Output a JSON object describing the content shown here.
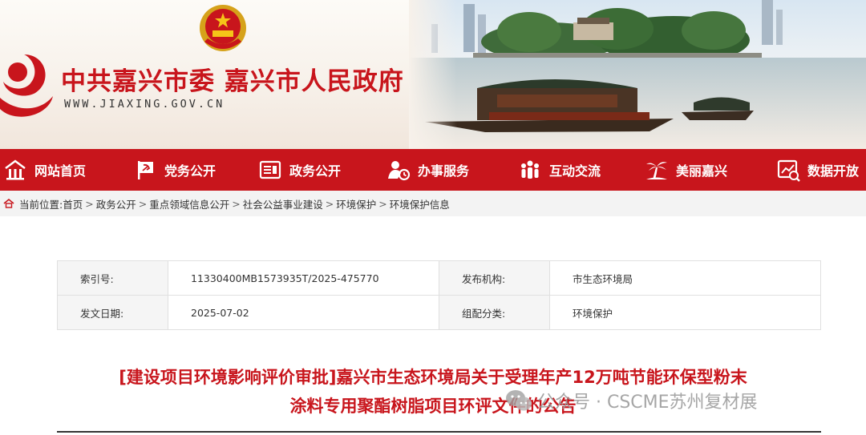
{
  "header": {
    "site_title": "中共嘉兴市委  嘉兴市人民政府",
    "site_url": "WWW.JIAXING.GOV.CN"
  },
  "nav": {
    "items": [
      {
        "label": "网站首页",
        "icon": "home-icon"
      },
      {
        "label": "党务公开",
        "icon": "party-flag-icon"
      },
      {
        "label": "政务公开",
        "icon": "document-icon"
      },
      {
        "label": "办事服务",
        "icon": "service-icon"
      },
      {
        "label": "互动交流",
        "icon": "people-icon"
      },
      {
        "label": "美丽嘉兴",
        "icon": "palm-tree-icon"
      },
      {
        "label": "数据开放",
        "icon": "data-icon"
      }
    ]
  },
  "breadcrumb": {
    "prefix": "当前位置:",
    "items": [
      "首页",
      "政务公开",
      "重点领域信息公开",
      "社会公益事业建设",
      "环境保护",
      "环境保护信息"
    ],
    "separator": ">"
  },
  "info": {
    "index_label": "索引号:",
    "index_value": "11330400MB1573935T/2025-475770",
    "publisher_label": "发布机构:",
    "publisher_value": "市生态环境局",
    "date_label": "发文日期:",
    "date_value": "2025-07-02",
    "category_label": "组配分类:",
    "category_value": "环境保护"
  },
  "article": {
    "title_line1": "[建设项目环境影响评价审批]嘉兴市生态环境局关于受理年产12万吨节能环保型粉末",
    "title_line2": "涂料专用聚酯树脂项目环评文件的公告"
  },
  "watermark": {
    "text": "公众号 · CSCME苏州复材展"
  },
  "colors": {
    "brand_red": "#c8151c",
    "breadcrumb_bg": "#f3f3f3",
    "label_bg": "#f5f5f5"
  }
}
